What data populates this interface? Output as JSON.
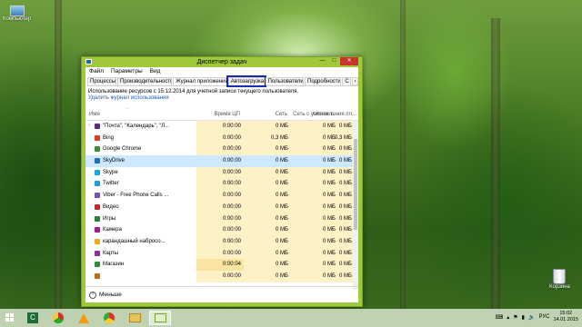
{
  "desktop": {
    "icons": [
      {
        "name": "computer",
        "label": "Компьютер"
      },
      {
        "name": "recycle-bin",
        "label": "Корзина"
      }
    ]
  },
  "window": {
    "title": "Диспетчер задач",
    "menu": [
      "Файл",
      "Параметры",
      "Вид"
    ],
    "tabs": [
      "Процессы",
      "Производительность",
      "Журнал приложений",
      "Автозагрузка",
      "Пользователи",
      "Подробности",
      "С"
    ],
    "active_tab": "Журнал приложений",
    "info_text": "Использование ресурсов с 15.12.2014 для учетной записи текущего пользователя.",
    "delete_link": "Удалить журнал использования",
    "columns": [
      "Имя",
      "Время ЦП",
      "Сеть",
      "Сеть с учетом т...",
      "Обновления пл..."
    ],
    "rows": [
      {
        "name": "\"Почта\", \"Календарь\", \"Л...",
        "cpu": "0:00:00",
        "net": "0 МБ",
        "metered": "0 МБ",
        "tile": "0 МБ",
        "icon_color": "#5b2c83",
        "expandable": true
      },
      {
        "name": "Bing",
        "cpu": "0:00:00",
        "net": "0,3 МБ",
        "metered": "0 МБ",
        "tile": "0,3 МБ",
        "icon_color": "#e23d28"
      },
      {
        "name": "Google Chrome",
        "cpu": "0:00:00",
        "net": "0 МБ",
        "metered": "0 МБ",
        "tile": "0 МБ",
        "icon_color": "#3a8f3a"
      },
      {
        "name": "SkyDrive",
        "cpu": "0:00:00",
        "net": "0 МБ",
        "metered": "0 МБ",
        "tile": "0 МБ",
        "icon_color": "#1e6fc1",
        "selected": true
      },
      {
        "name": "Skype",
        "cpu": "0:00:00",
        "net": "0 МБ",
        "metered": "0 МБ",
        "tile": "0 МБ",
        "icon_color": "#16a9e8"
      },
      {
        "name": "Twitter",
        "cpu": "0:00:00",
        "net": "0 МБ",
        "metered": "0 МБ",
        "tile": "0 МБ",
        "icon_color": "#1fa0dc"
      },
      {
        "name": "Viber - Free Phone Calls ...",
        "cpu": "0:00:00",
        "net": "0 МБ",
        "metered": "0 МБ",
        "tile": "0 МБ",
        "icon_color": "#7b4fb3"
      },
      {
        "name": "Видео",
        "cpu": "0:00:00",
        "net": "0 МБ",
        "metered": "0 МБ",
        "tile": "0 МБ",
        "icon_color": "#c4262e"
      },
      {
        "name": "Игры",
        "cpu": "0:00:00",
        "net": "0 МБ",
        "metered": "0 МБ",
        "tile": "0 МБ",
        "icon_color": "#2d7d32"
      },
      {
        "name": "Камера",
        "cpu": "0:00:00",
        "net": "0 МБ",
        "metered": "0 МБ",
        "tile": "0 МБ",
        "icon_color": "#9b1d8e"
      },
      {
        "name": "карандашный набросо...",
        "cpu": "0:00:00",
        "net": "0 МБ",
        "metered": "0 МБ",
        "tile": "0 МБ",
        "icon_color": "#f2a81d"
      },
      {
        "name": "Карты",
        "cpu": "0:00:00",
        "net": "0 МБ",
        "metered": "0 МБ",
        "tile": "0 МБ",
        "icon_color": "#8e2f9a"
      },
      {
        "name": "Магазин",
        "cpu": "0:00:04",
        "net": "0 МБ",
        "metered": "0 МБ",
        "tile": "0 МБ",
        "icon_color": "#2e8b3f",
        "hot": true
      },
      {
        "name": "",
        "cpu": "0:00:00",
        "net": "0 МБ",
        "metered": "0 МБ",
        "tile": "0 МБ",
        "icon_color": "#c26a1a"
      }
    ],
    "less_label": "Меньше"
  },
  "taskbar": {
    "apps": [
      "task-manager",
      "chrome-alt",
      "media-player",
      "chrome",
      "file-explorer",
      "task-manager-window"
    ],
    "tray_lang": "РУС",
    "time": "15:02",
    "date": "14.01.2015"
  },
  "colors": {
    "window_frame": "#9fc93a",
    "cpu_column": "#fdf1c6",
    "selected_row": "#cde8ff",
    "focus_outline": "#1a2fb0",
    "close_button": "#c7352a"
  }
}
